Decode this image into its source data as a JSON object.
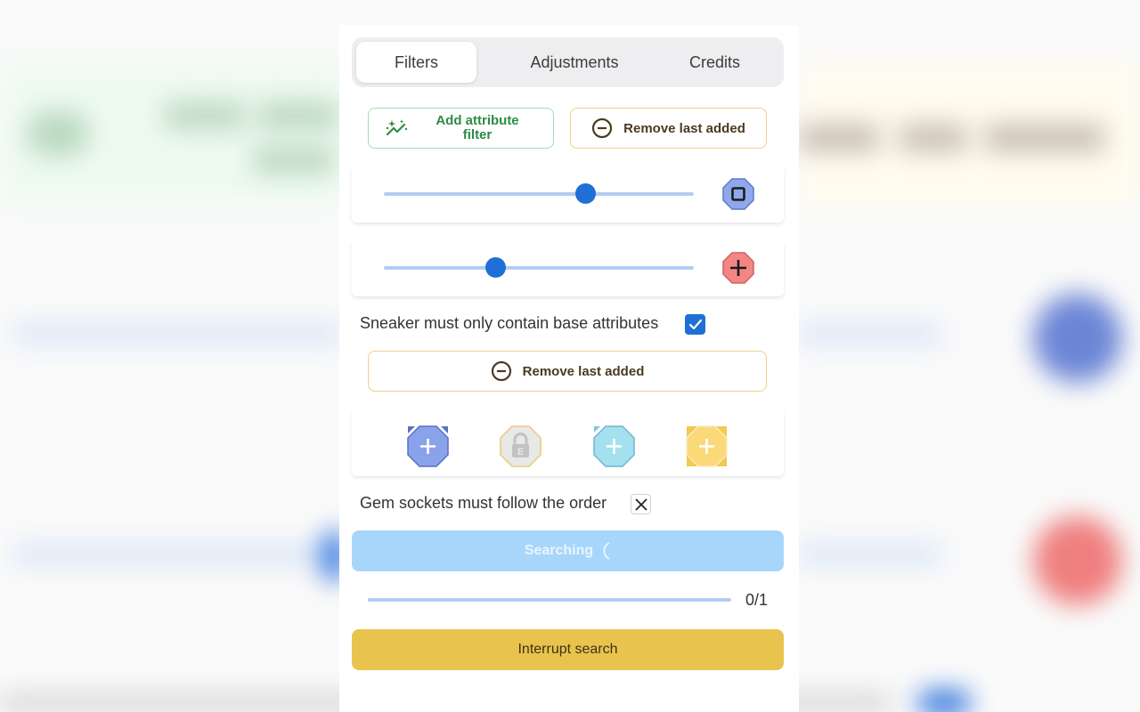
{
  "tabs": [
    {
      "label": "Filters",
      "active": true
    },
    {
      "label": "Adjustments",
      "active": false
    },
    {
      "label": "Credits",
      "active": false
    }
  ],
  "actions": {
    "add_attribute_filter": "Add attribute filter",
    "remove_last_added": "Remove last added"
  },
  "attribute_filters": [
    {
      "icon": "stop-square-icon",
      "color": "#8fa8ec",
      "value_fraction": 0.65
    },
    {
      "icon": "plus-icon",
      "color": "#f48585",
      "value_fraction": 0.36
    }
  ],
  "base_attributes": {
    "label": "Sneaker must only contain base attributes",
    "checked": true
  },
  "sockets_remove_label": "Remove last added",
  "gem_sockets": [
    {
      "name": "blue",
      "state": "add",
      "color": "#8aa2ea"
    },
    {
      "name": "locked",
      "state": "locked",
      "lock_letter": "E",
      "color": "#e6e6e6"
    },
    {
      "name": "cyan",
      "state": "add",
      "color": "#a5e0ef"
    },
    {
      "name": "yellow",
      "state": "add",
      "color": "#fbd978"
    }
  ],
  "sockets_order": {
    "label": "Gem sockets must follow the order",
    "checked": false
  },
  "search": {
    "label": "Searching",
    "progress_text": "0/1",
    "progress_fraction": 0
  },
  "interrupt_label": "Interrupt search",
  "colors": {
    "accent": "#1f6fd6",
    "green": "#2e8b45",
    "yellow": "#e8c44e",
    "search_disabled": "#a8d6fb"
  }
}
